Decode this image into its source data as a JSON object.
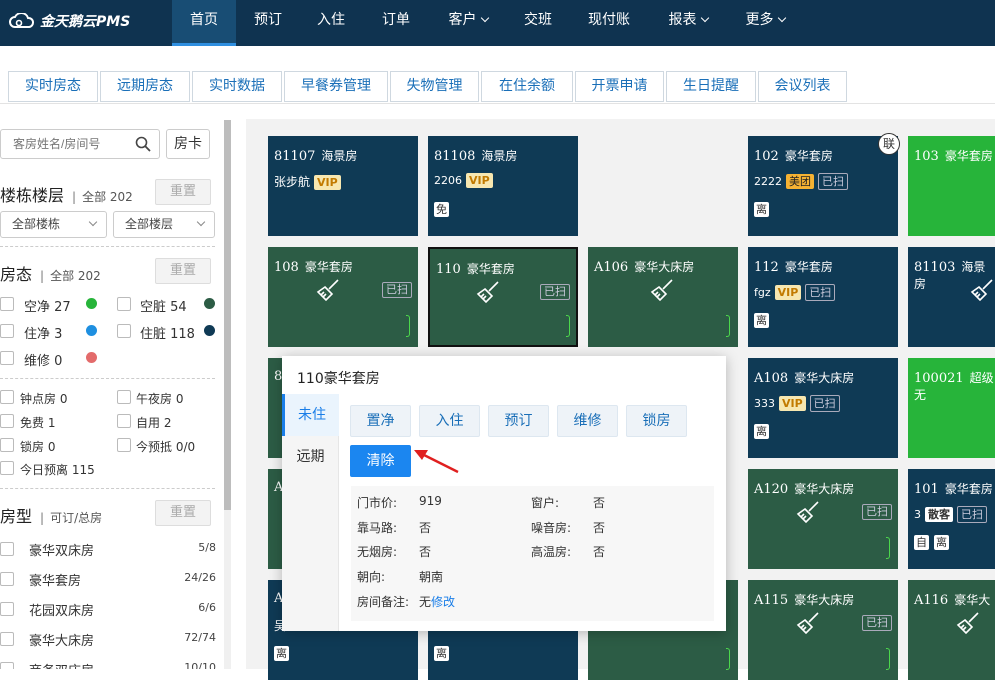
{
  "app": {
    "name": "金天鹅云PMS"
  },
  "nav": {
    "items": [
      {
        "label": "首页",
        "active": true
      },
      {
        "label": "预订"
      },
      {
        "label": "入住"
      },
      {
        "label": "订单"
      },
      {
        "label": "客户",
        "dropdown": true
      },
      {
        "label": "交班"
      },
      {
        "label": "现付账"
      },
      {
        "label": "报表",
        "dropdown": true
      },
      {
        "label": "更多",
        "dropdown": true
      }
    ]
  },
  "subtabs": [
    "实时房态",
    "远期房态",
    "实时数据",
    "早餐券管理",
    "失物管理",
    "在住余额",
    "开票申请",
    "生日提醒",
    "会议列表"
  ],
  "left": {
    "search_placeholder": "客房姓名/房间号",
    "fangka": "房卡",
    "building": {
      "title": "楼栋楼层",
      "count": "全部 202",
      "reset": "重置",
      "dd1": "全部楼栋",
      "dd2": "全部楼层"
    },
    "status": {
      "title": "房态",
      "count": "全部 202",
      "reset": "重置",
      "items": [
        {
          "label": "空净 27",
          "color": "#27b43a"
        },
        {
          "label": "空脏 54",
          "color": "#2c5c45"
        },
        {
          "label": "住净 3",
          "color": "#1e8fe0"
        },
        {
          "label": "住脏 118",
          "color": "#0f3a55"
        },
        {
          "label": "维修 0",
          "color": "#e36b6b"
        }
      ]
    },
    "flags": [
      "钟点房 0",
      "午夜房 0",
      "免费 1",
      "自用 2",
      "锁房 0",
      "今预抵 0/0",
      "今日预离 115"
    ],
    "roomtype": {
      "title": "房型",
      "count": "可订/总房",
      "reset": "重置",
      "items": [
        {
          "name": "豪华双床房",
          "count": "5/8"
        },
        {
          "name": "豪华套房",
          "count": "24/26"
        },
        {
          "name": "花园双床房",
          "count": "6/6"
        },
        {
          "name": "豪华大床房",
          "count": "72/74"
        },
        {
          "name": "商务双床房",
          "count": "10/10"
        }
      ]
    }
  },
  "colors": {
    "occupied_dirty": "#0f3a55",
    "vacant_dirty": "#2c5c45",
    "vacant_clean": "#27b43a",
    "nav_bg": "#0f3350",
    "accent": "#1b86f0"
  },
  "rooms": {
    "r1": {
      "no": "81107",
      "type": "海景房",
      "guest": "张步航",
      "vip": "VIP"
    },
    "r2": {
      "no": "81108",
      "type": "海景房",
      "guest": "2206",
      "vip": "VIP",
      "tag": "免"
    },
    "r3": {
      "no": "102",
      "type": "豪华套房",
      "guest": "2222",
      "mt": "美团",
      "sc": "已扫",
      "tag": "离",
      "corner": "联"
    },
    "r4": {
      "no": "103",
      "type": "豪华套房"
    },
    "r5": {
      "no": "108",
      "type": "豪华套房",
      "sc": "已扫"
    },
    "r6": {
      "no": "110",
      "type": "豪华套房",
      "sc": "已扫"
    },
    "r7": {
      "no": "A106",
      "type": "豪华大床房"
    },
    "r8": {
      "no": "112",
      "type": "豪华套房",
      "guest": "fgz",
      "vip": "VIP",
      "sc": "已扫",
      "tag": "离"
    },
    "r9": {
      "no": "81103",
      "type": "海景房"
    },
    "r10": {
      "no": "A108",
      "type": "豪华大床房",
      "guest": "333",
      "vip": "VIP",
      "sc": "已扫",
      "tag": "离"
    },
    "r11": {
      "no": "100021",
      "type": "超级无"
    },
    "r12": {
      "no": "A120",
      "type": "豪华大床房",
      "sc": "已扫"
    },
    "r13": {
      "no": "101",
      "type": "豪华套房",
      "guest": "3",
      "gk": "散客",
      "sc": "已扫",
      "tag": "自",
      "tag2": "离"
    },
    "r14": {
      "no": "A115",
      "type": "豪华大床房",
      "sc": "已扫"
    },
    "r15": {
      "no": "A116",
      "type": "豪华大"
    },
    "p1": {
      "no": "8"
    },
    "p2": {
      "no": "A"
    },
    "p3": {
      "no": "A",
      "guest": "吴"
    },
    "tag_li": "离"
  },
  "popup": {
    "title": "110豪华套房",
    "tabs": [
      "未住",
      "远期"
    ],
    "buttons": [
      "置净",
      "入住",
      "预订",
      "维修",
      "锁房"
    ],
    "clear": "清除",
    "info": {
      "price_k": "门市价:",
      "price_v": "919",
      "win_k": "窗户:",
      "win_v": "否",
      "road_k": "靠马路:",
      "road_v": "否",
      "noise_k": "噪音房:",
      "noise_v": "否",
      "smoke_k": "无烟房:",
      "smoke_v": "否",
      "temp_k": "高温房:",
      "temp_v": "否",
      "face_k": "朝向:",
      "face_v": "朝南",
      "note_k": "房间备注:",
      "note_v": "无",
      "note_link": "修改"
    }
  }
}
